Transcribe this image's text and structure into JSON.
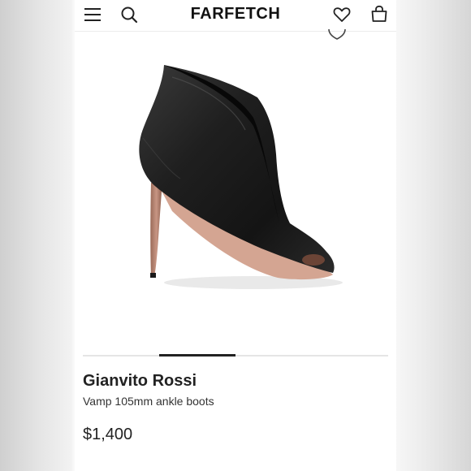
{
  "header": {
    "logo": "FARFETCH",
    "icons": [
      "menu-icon",
      "search-icon",
      "heart-icon",
      "shopping-bag-icon"
    ]
  },
  "product": {
    "brand": "Gianvito Rossi",
    "name": "Vamp 105mm ankle boots",
    "price": "$1,400",
    "image_count_active": 2
  },
  "colors": {
    "text": "#222222",
    "background": "#ffffff",
    "accent": "#111111"
  }
}
